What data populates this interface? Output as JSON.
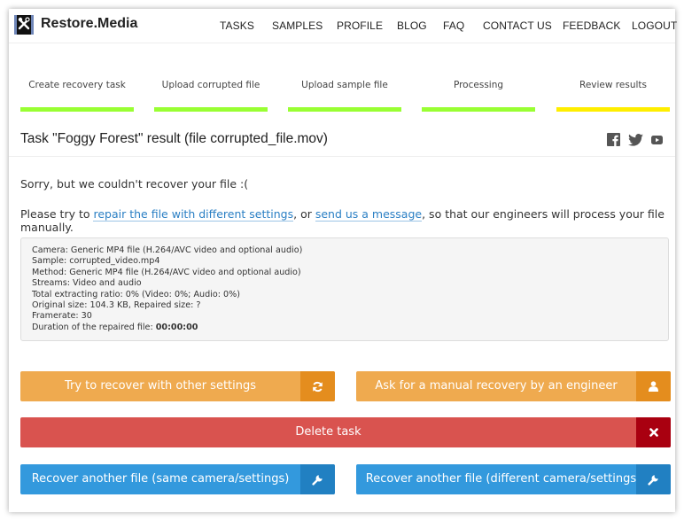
{
  "header": {
    "brand": "Restore.Media",
    "logo_icon": "film-tools-icon",
    "nav": [
      "TASKS",
      "SAMPLES",
      "PROFILE",
      "BLOG",
      "FAQ",
      "CONTACT US",
      "FEEDBACK",
      "LOGOUT"
    ]
  },
  "steps": [
    {
      "label": "Create recovery task",
      "status": "done",
      "color": "#99ff33"
    },
    {
      "label": "Upload corrupted file",
      "status": "done",
      "color": "#99ff33"
    },
    {
      "label": "Upload sample file",
      "status": "done",
      "color": "#99ff33"
    },
    {
      "label": "Processing",
      "status": "done",
      "color": "#99ff33"
    },
    {
      "label": "Review results",
      "status": "current",
      "color": "#ffee00"
    }
  ],
  "task": {
    "title": "Task \"Foggy Forest\" result (file corrupted_file.mov)",
    "social_icons": [
      "facebook-icon",
      "twitter-icon",
      "youtube-icon"
    ]
  },
  "message": {
    "sorry": "Sorry, but we couldn't recover your file :(",
    "try_prefix": "Please try to ",
    "link_repair": "repair the file with different settings",
    "middle": ", or ",
    "link_message": "send us a message",
    "suffix": ", so that our engineers will process your file manually."
  },
  "info": {
    "camera": "Camera:  Generic MP4 file (H.264/AVC video and optional audio)",
    "sample": "Sample: corrupted_video.mp4",
    "method": "Method:  Generic MP4 file (H.264/AVC video and optional audio)",
    "streams": "Streams: Video and audio",
    "ratio": "Total extracting ratio: 0% (Video: 0%; Audio: 0%)",
    "sizes": "Original size: 104.3 KB, Repaired size: ?",
    "framerate": "Framerate: 30",
    "duration_label": "Duration of the repaired file: ",
    "duration_value": "00:00:00"
  },
  "buttons": {
    "retry": {
      "label": "Try to recover with other settings",
      "icon": "refresh-icon",
      "color": "#efaa4f"
    },
    "manual": {
      "label": "Ask for a manual recovery by an engineer",
      "icon": "user-icon",
      "color": "#efaa4f"
    },
    "delete": {
      "label": "Delete task",
      "icon": "close-icon",
      "color": "#d9534f"
    },
    "same": {
      "label": "Recover another file (same camera/settings)",
      "icon": "wrench-icon",
      "color": "#3399dd"
    },
    "different": {
      "label": "Recover another file (different camera/settings)",
      "icon": "wrench-icon",
      "color": "#3399dd"
    }
  }
}
